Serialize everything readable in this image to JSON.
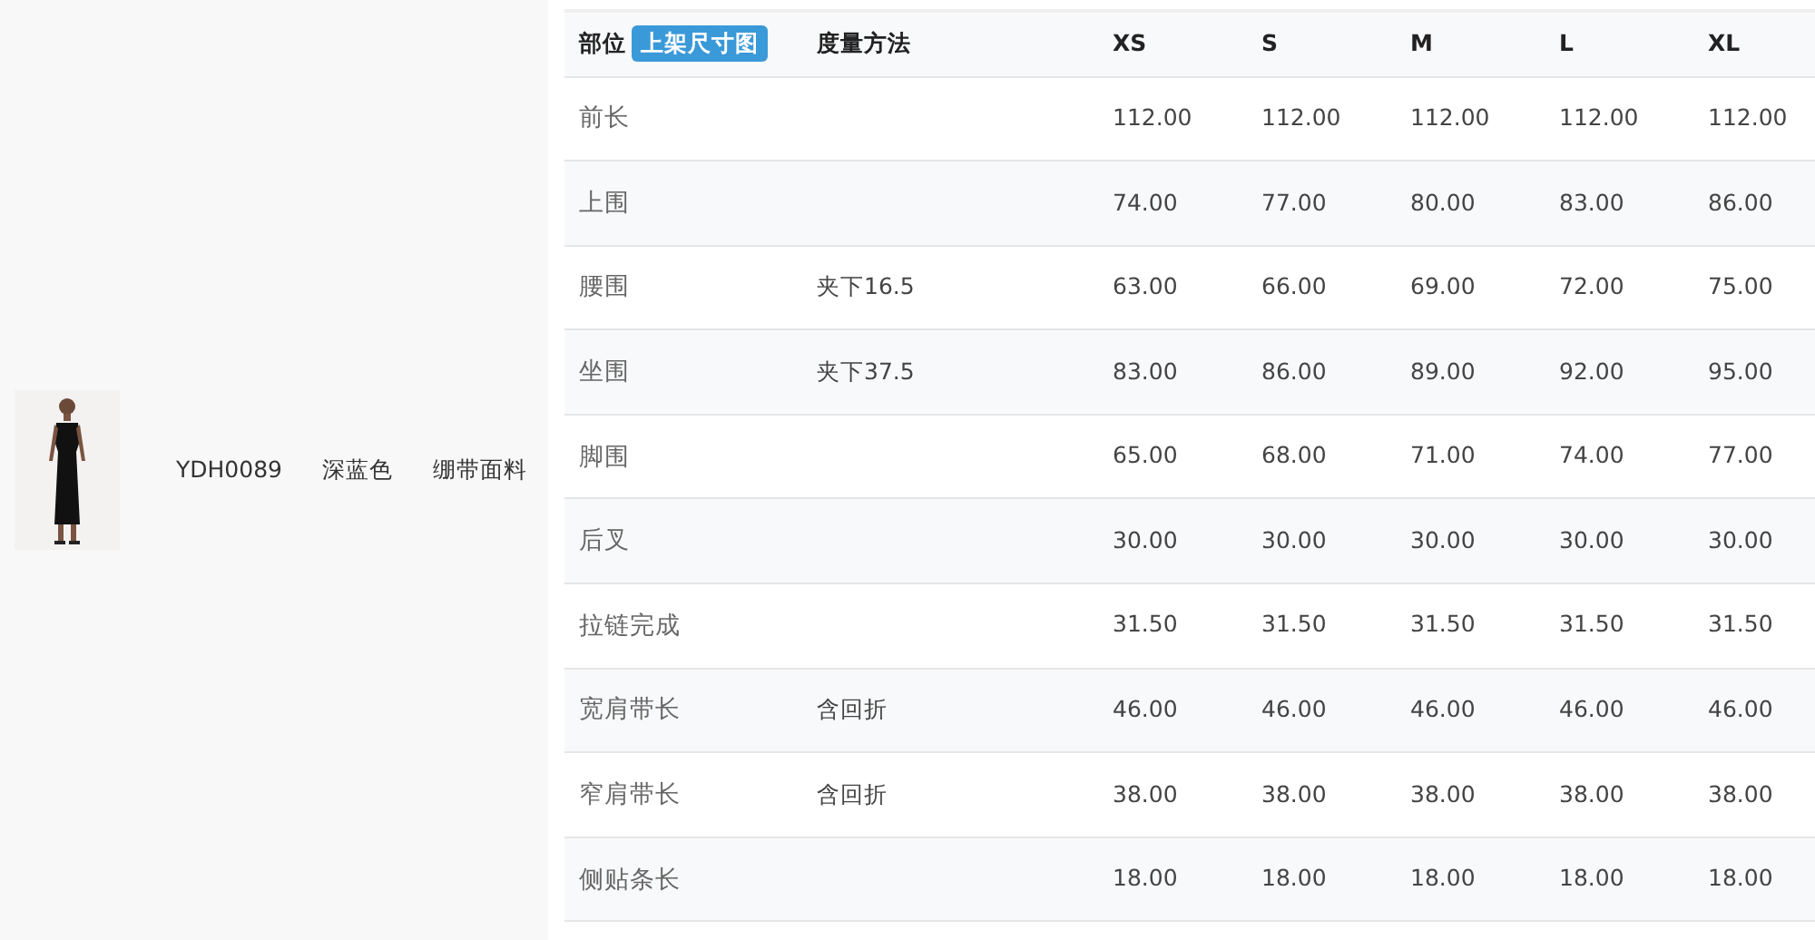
{
  "product": {
    "code": "YDH0089",
    "color_name": "深蓝色",
    "fabric": "绷带面料"
  },
  "table": {
    "columns": [
      {
        "label": "部位",
        "button": "上架尺寸图"
      },
      {
        "label": "度量方法"
      },
      {
        "label": "XS"
      },
      {
        "label": "S"
      },
      {
        "label": "M"
      },
      {
        "label": "L"
      },
      {
        "label": "XL"
      }
    ],
    "rows": [
      {
        "part": "前长",
        "method": "",
        "values": [
          "112.00",
          "112.00",
          "112.00",
          "112.00",
          "112.00"
        ]
      },
      {
        "part": "上围",
        "method": "",
        "values": [
          "74.00",
          "77.00",
          "80.00",
          "83.00",
          "86.00"
        ]
      },
      {
        "part": "腰围",
        "method": "夹下16.5",
        "values": [
          "63.00",
          "66.00",
          "69.00",
          "72.00",
          "75.00"
        ]
      },
      {
        "part": "坐围",
        "method": "夹下37.5",
        "values": [
          "83.00",
          "86.00",
          "89.00",
          "92.00",
          "95.00"
        ]
      },
      {
        "part": "脚围",
        "method": "",
        "values": [
          "65.00",
          "68.00",
          "71.00",
          "74.00",
          "77.00"
        ]
      },
      {
        "part": "后叉",
        "method": "",
        "values": [
          "30.00",
          "30.00",
          "30.00",
          "30.00",
          "30.00"
        ]
      },
      {
        "part": "拉链完成",
        "method": "",
        "values": [
          "31.50",
          "31.50",
          "31.50",
          "31.50",
          "31.50"
        ]
      },
      {
        "part": "宽肩带长",
        "method": "含回折",
        "values": [
          "46.00",
          "46.00",
          "46.00",
          "46.00",
          "46.00"
        ]
      },
      {
        "part": "窄肩带长",
        "method": "含回折",
        "values": [
          "38.00",
          "38.00",
          "38.00",
          "38.00",
          "38.00"
        ]
      },
      {
        "part": "侧贴条长",
        "method": "",
        "values": [
          "18.00",
          "18.00",
          "18.00",
          "18.00",
          "18.00"
        ]
      }
    ]
  }
}
